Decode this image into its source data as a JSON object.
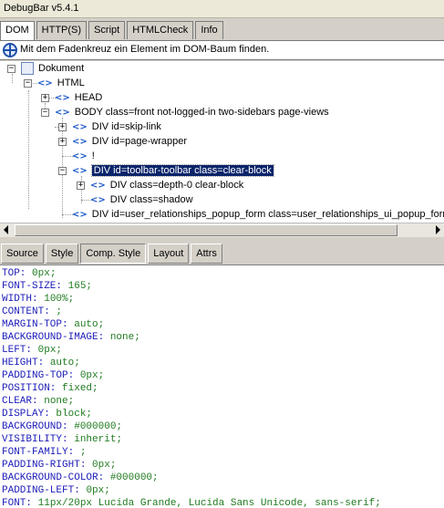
{
  "window": {
    "title": "DebugBar v5.4.1"
  },
  "tabs": [
    {
      "label": "DOM",
      "active": true
    },
    {
      "label": "HTTP(S)",
      "active": false
    },
    {
      "label": "Script",
      "active": false
    },
    {
      "label": "HTMLCheck",
      "active": false
    },
    {
      "label": "Info",
      "active": false
    }
  ],
  "hint": {
    "text": "Mit dem Fadenkreuz ein Element im DOM-Baum finden.",
    "icon": "crosshair-icon"
  },
  "tree": {
    "nodes": [
      {
        "label": "Dokument",
        "icon": "document-icon",
        "expander": "−"
      },
      {
        "label": "HTML",
        "icon": "tag-icon",
        "expander": "−"
      },
      {
        "label": "HEAD",
        "icon": "tag-icon",
        "expander": "+"
      },
      {
        "label": "BODY class=front not-logged-in two-sidebars page-views",
        "icon": "tag-icon",
        "expander": "−"
      },
      {
        "label": "DIV id=skip-link",
        "icon": "tag-icon",
        "expander": "+"
      },
      {
        "label": "DIV id=page-wrapper",
        "icon": "tag-icon",
        "expander": "+"
      },
      {
        "label": "!",
        "icon": "tag-icon",
        "expander": ""
      },
      {
        "label": "DIV id=toolbar-toolbar class=clear-block",
        "icon": "tag-icon",
        "expander": "−",
        "selected": true
      },
      {
        "label": "DIV class=depth-0 clear-block",
        "icon": "tag-icon",
        "expander": "+"
      },
      {
        "label": "DIV class=shadow",
        "icon": "tag-icon",
        "expander": ""
      },
      {
        "label": "DIV id=user_relationships_popup_form class=user_relationships_ui_popup_form",
        "icon": "tag-icon",
        "expander": ""
      }
    ]
  },
  "subtabs": [
    {
      "label": "Source",
      "active": false
    },
    {
      "label": "Style",
      "active": false
    },
    {
      "label": "Comp. Style",
      "active": true
    },
    {
      "label": "Layout",
      "active": false
    },
    {
      "label": "Attrs",
      "active": false
    }
  ],
  "computed_style": [
    {
      "prop": "TOP:",
      "val": "0px;"
    },
    {
      "prop": "FONT-SIZE:",
      "val": "165;"
    },
    {
      "prop": "WIDTH:",
      "val": "100%;"
    },
    {
      "prop": "CONTENT:",
      "val": ";"
    },
    {
      "prop": "MARGIN-TOP:",
      "val": "auto;"
    },
    {
      "prop": "BACKGROUND-IMAGE:",
      "val": "none;"
    },
    {
      "prop": "LEFT:",
      "val": "0px;"
    },
    {
      "prop": "HEIGHT:",
      "val": "auto;"
    },
    {
      "prop": "PADDING-TOP:",
      "val": "0px;"
    },
    {
      "prop": "POSITION:",
      "val": "fixed;"
    },
    {
      "prop": "CLEAR:",
      "val": "none;"
    },
    {
      "prop": "DISPLAY:",
      "val": "block;"
    },
    {
      "prop": "BACKGROUND:",
      "val": "#000000;"
    },
    {
      "prop": "VISIBILITY:",
      "val": "inherit;"
    },
    {
      "prop": "FONT-FAMILY:",
      "val": ";"
    },
    {
      "prop": "PADDING-RIGHT:",
      "val": "0px;"
    },
    {
      "prop": "BACKGROUND-COLOR:",
      "val": "#000000;"
    },
    {
      "prop": "PADDING-LEFT:",
      "val": "0px;"
    },
    {
      "prop": "FONT:",
      "val": "11px/20px Lucida Grande, Lucida Sans Unicode, sans-serif;"
    }
  ]
}
